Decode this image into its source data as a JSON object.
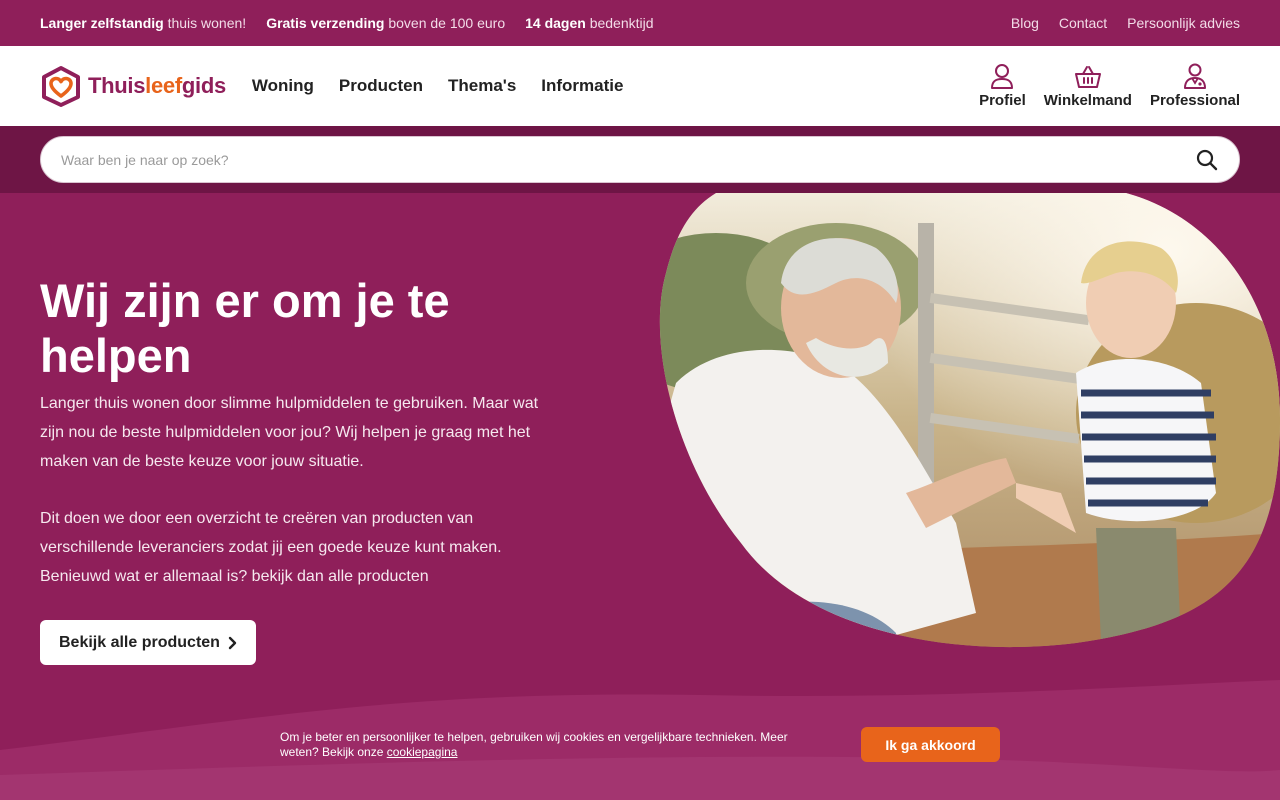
{
  "topbar": {
    "usps": [
      {
        "bold": "Langer zelfstandig",
        "rest": " thuis wonen!"
      },
      {
        "bold": "Gratis verzending",
        "rest": " boven de 100 euro"
      },
      {
        "bold": "14 dagen",
        "rest": " bedenktijd"
      }
    ],
    "links": [
      "Blog",
      "Contact",
      "Persoonlijk advies"
    ]
  },
  "header": {
    "logo": {
      "part1": "Thuis",
      "part2": "leef",
      "part3": "gids"
    },
    "nav": [
      "Woning",
      "Producten",
      "Thema's",
      "Informatie"
    ],
    "user": {
      "profile": "Profiel",
      "cart": "Winkelmand",
      "professional": "Professional"
    }
  },
  "search": {
    "placeholder": "Waar ben je naar op zoek?"
  },
  "hero": {
    "title": "Wij zijn er om je te helpen",
    "paragraph1": "Langer thuis wonen door slimme hulpmiddelen te gebruiken. Maar wat zijn nou de beste hulpmiddelen voor jou? Wij helpen je graag met het maken van de beste keuze voor jouw situatie.",
    "paragraph2": "Dit doen we door een overzicht te creëren van producten van verschillende leveranciers zodat jij een goede keuze kunt maken. Benieuwd wat er allemaal is? bekijk dan alle producten",
    "cta": "Bekijk alle producten"
  },
  "cookie": {
    "text": "Om je beter en persoonlijker te helpen, gebruiken wij cookies en vergelijkbare technieken. Meer weten? Bekijk onze ",
    "link": "cookiepagina",
    "accept": "Ik ga akkoord"
  },
  "colors": {
    "brand": "#8f1f5a",
    "brand_dark": "#6e1545",
    "accent": "#e8641b"
  }
}
